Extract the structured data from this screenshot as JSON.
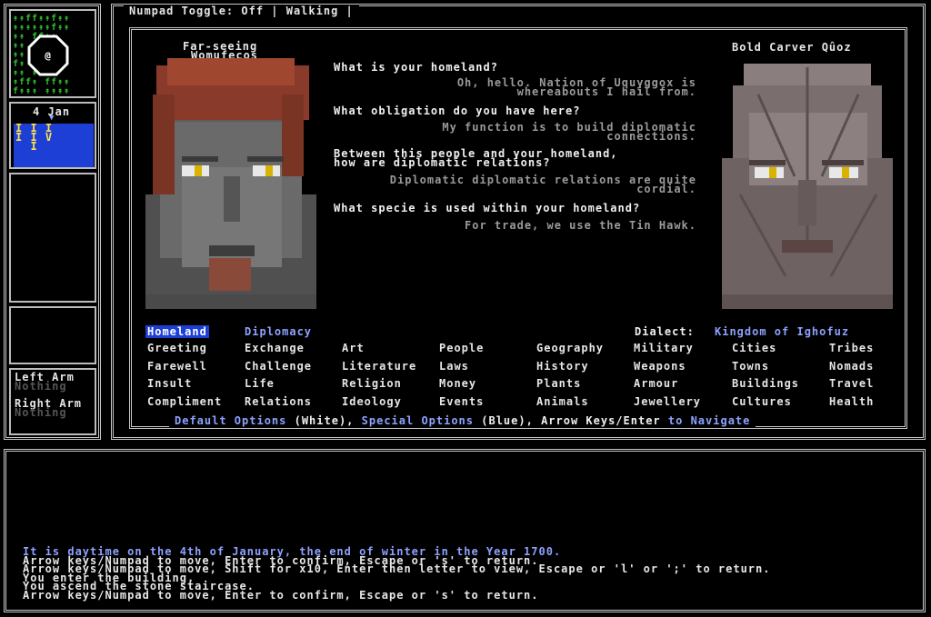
{
  "status_bar": "Numpad Toggle: Off | Walking |",
  "minimap": {
    "rows": [
      [
        "↟↟↟↟f",
        "↟↟↟↟"
      ],
      [
        "↟↟ffff",
        "↟↟"
      ]
    ],
    "player": "@"
  },
  "calendar": {
    "date": "4 Jan",
    "marker": "▼",
    "rows": [
      "I I I",
      "I I V",
      "  I"
    ]
  },
  "equipment": {
    "left_label": "Left Arm",
    "left_value": "Nothing",
    "right_label": "Right Arm",
    "right_value": "Nothing"
  },
  "dialogue": {
    "left_name_line1": "Far-seeing",
    "left_name_line2": "Womufecos",
    "right_name": "Bold Carver Qûoz",
    "lines": [
      {
        "q": "What is your homeland?",
        "a1": "Oh, hello. Nation of Uquyggox is",
        "a2": "whereabouts I hail from."
      },
      {
        "q": "What obligation do you have here?",
        "a1": "My function is to build diplomatic",
        "a2": "connections."
      },
      {
        "q": "Between this people and your homeland,",
        "q2": "how are diplomatic relations?",
        "a1": "Diplomatic diplomatic relations are quite",
        "a2": "cordial."
      },
      {
        "q": "What specie is used within your homeland?",
        "a1": "For trade, we use the Tin Hawk."
      }
    ]
  },
  "topics": {
    "selected": "Homeland",
    "diplomacy": "Diplomacy",
    "dialect_label": "Dialect:",
    "dialect_value": "Kingdom of Ighofuz",
    "columns": [
      [
        "Greeting",
        "Farewell",
        "Insult",
        "Compliment"
      ],
      [
        "Exchange",
        "Challenge",
        "Life",
        "Relations"
      ],
      [
        "Art",
        "Literature",
        "Religion",
        "Ideology"
      ],
      [
        "People",
        "Laws",
        "Money",
        "Events"
      ],
      [
        "Geography",
        "History",
        "Plants",
        "Animals"
      ],
      [
        "Military",
        "Weapons",
        "Armour",
        "Jewellery"
      ],
      [
        "Cities",
        "Towns",
        "Buildings",
        "Cultures"
      ],
      [
        "Tribes",
        "Nomads",
        "Travel",
        "Health"
      ]
    ],
    "help": {
      "p1": "Default Options",
      "p2": "(White),",
      "p3": "Special Options",
      "p4": "(Blue),",
      "p5": "Arrow Keys/Enter",
      "p6": "to Navigate"
    }
  },
  "messages": [
    "It is daytime on the 4th of January, the end of winter in the Year 1700.",
    "Arrow keys/Numpad to move, Enter to confirm, Escape or 's' to return.",
    "Arrow keys/Numpad to move, Shift for x10, Enter then letter to view, Escape or 'l' or ';' to return.",
    "You enter the building.",
    "You ascend the stone staircase.",
    "Arrow keys/Numpad to move, Enter to confirm, Escape or 's' to return."
  ],
  "colors": {
    "accent_blue": "#1e3fd6",
    "special_text": "#8da2ff",
    "tree_green": "#2fbf2f"
  }
}
